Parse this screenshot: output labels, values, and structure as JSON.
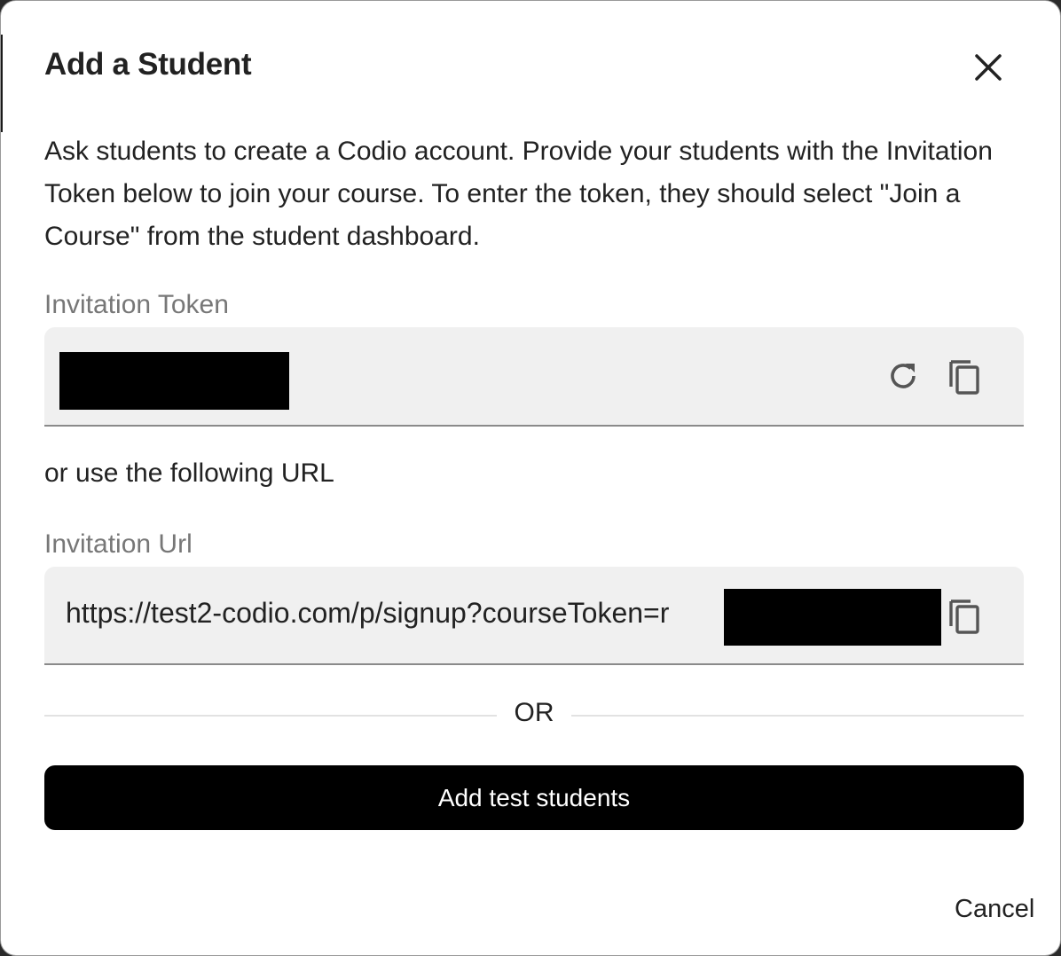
{
  "dialog": {
    "title": "Add a Student",
    "close_icon": "close-icon",
    "description": "Ask students to create a Codio account. Provide your students with the Invitation Token below to join your course. To enter the token, they should select \"Join a Course\" from the student dashboard."
  },
  "token_field": {
    "label": "Invitation Token",
    "refresh_icon": "refresh-icon",
    "copy_icon": "copy-icon"
  },
  "alt_text": "or use the following URL",
  "url_field": {
    "label": "Invitation Url",
    "value": "https://test2-codio.com/p/signup?courseToken=r",
    "copy_icon": "copy-icon"
  },
  "divider": {
    "label": "OR"
  },
  "actions": {
    "add_test_students": "Add test students",
    "cancel": "Cancel"
  },
  "colors": {
    "primary_button_bg": "#000000",
    "field_bg": "#f0f0f0",
    "label_text": "#777777",
    "body_text": "#222222"
  }
}
